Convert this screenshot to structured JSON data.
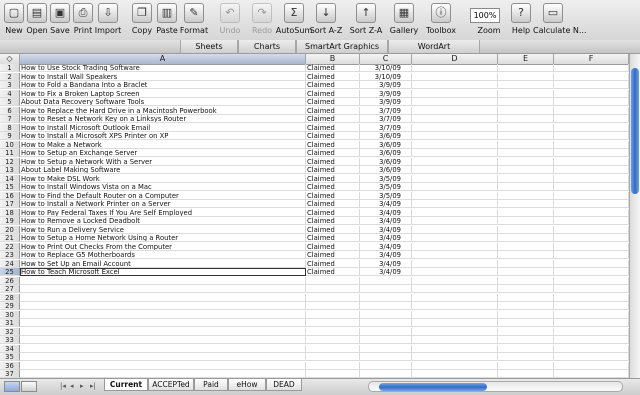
{
  "toolbar": {
    "buttons": [
      {
        "label": "New",
        "glyph": "▢",
        "disabled": false
      },
      {
        "label": "Open",
        "glyph": "▤",
        "disabled": false
      },
      {
        "label": "Save",
        "glyph": "▣",
        "disabled": false
      },
      {
        "label": "Print",
        "glyph": "⎙",
        "disabled": false
      },
      {
        "label": "Import",
        "glyph": "⇩",
        "disabled": false
      },
      {
        "label": "Copy",
        "glyph": "❐",
        "disabled": false
      },
      {
        "label": "Paste",
        "glyph": "▥",
        "disabled": false
      },
      {
        "label": "Format",
        "glyph": "✎",
        "disabled": false
      },
      {
        "label": "Undo",
        "glyph": "↶",
        "disabled": true
      },
      {
        "label": "Redo",
        "glyph": "↷",
        "disabled": true
      },
      {
        "label": "AutoSum",
        "glyph": "Σ",
        "disabled": false
      },
      {
        "label": "Sort A-Z",
        "glyph": "↓",
        "disabled": false
      },
      {
        "label": "Sort Z-A",
        "glyph": "↑",
        "disabled": false
      },
      {
        "label": "Gallery",
        "glyph": "▦",
        "disabled": false
      },
      {
        "label": "Toolbox",
        "glyph": "ⓘ",
        "disabled": false
      },
      {
        "label": "Zoom",
        "glyph": "",
        "disabled": false
      },
      {
        "label": "Help",
        "glyph": "?",
        "disabled": false
      },
      {
        "label": "Calculate N...",
        "glyph": "▭",
        "disabled": false
      }
    ],
    "zoom_value": "100%"
  },
  "ribbon_tabs": [
    "Sheets",
    "Charts",
    "SmartArt Graphics",
    "WordArt"
  ],
  "columns": [
    {
      "label": "◇",
      "selected": false
    },
    {
      "label": "A",
      "selected": true
    },
    {
      "label": "B",
      "selected": false
    },
    {
      "label": "C",
      "selected": false
    },
    {
      "label": "D",
      "selected": false
    },
    {
      "label": "E",
      "selected": false
    },
    {
      "label": "F",
      "selected": false
    }
  ],
  "rows": [
    {
      "n": "1",
      "a": "How to Use Stock Trading Software",
      "b": "Claimed",
      "c": "3/10/09"
    },
    {
      "n": "2",
      "a": "How to Install Wall Speakers",
      "b": "Claimed",
      "c": "3/10/09"
    },
    {
      "n": "3",
      "a": "How to Fold a Bandana Into a Braclet",
      "b": "Claimed",
      "c": "3/9/09"
    },
    {
      "n": "4",
      "a": "How to Fix a Broken Laptop Screen",
      "b": "Claimed",
      "c": "3/9/09"
    },
    {
      "n": "5",
      "a": "About Data Recovery Software Tools",
      "b": "Claimed",
      "c": "3/9/09"
    },
    {
      "n": "6",
      "a": "How to Replace the Hard Drive in a Macintosh Powerbook",
      "b": "Claimed",
      "c": "3/7/09"
    },
    {
      "n": "7",
      "a": "How to Reset a Network Key on a Linksys Router",
      "b": "Claimed",
      "c": "3/7/09"
    },
    {
      "n": "8",
      "a": "How to Install Microsoft Outlook Email",
      "b": "Claimed",
      "c": "3/7/09"
    },
    {
      "n": "9",
      "a": "How to Install a Microsoft XPS Printer on XP",
      "b": "Claimed",
      "c": "3/6/09"
    },
    {
      "n": "10",
      "a": "How to Make a Network",
      "b": "Claimed",
      "c": "3/6/09"
    },
    {
      "n": "11",
      "a": "How to Setup an Exchange Server",
      "b": "Claimed",
      "c": "3/6/09"
    },
    {
      "n": "12",
      "a": "How to Setup a Network With a Server",
      "b": "Claimed",
      "c": "3/6/09"
    },
    {
      "n": "13",
      "a": "About Label Making Software",
      "b": "Claimed",
      "c": "3/6/09"
    },
    {
      "n": "14",
      "a": "How to Make DSL Work",
      "b": "Claimed",
      "c": "3/5/09"
    },
    {
      "n": "15",
      "a": "How to Install Windows Vista on a Mac",
      "b": "Claimed",
      "c": "3/5/09"
    },
    {
      "n": "16",
      "a": "How to Find the Default Router on a Computer",
      "b": "Claimed",
      "c": "3/5/09"
    },
    {
      "n": "17",
      "a": "How to Install a Network Printer on a Server",
      "b": "Claimed",
      "c": "3/4/09"
    },
    {
      "n": "18",
      "a": "How to Pay Federal Taxes If You Are Self Employed",
      "b": "Claimed",
      "c": "3/4/09"
    },
    {
      "n": "19",
      "a": "How to Remove a Locked Deadbolt",
      "b": "Claimed",
      "c": "3/4/09"
    },
    {
      "n": "20",
      "a": "How to Run a Delivery Service",
      "b": "Claimed",
      "c": "3/4/09"
    },
    {
      "n": "21",
      "a": "How to Setup a Home Network Using a Router",
      "b": "Claimed",
      "c": "3/4/09"
    },
    {
      "n": "22",
      "a": "How to Print Out Checks From the Computer",
      "b": "Claimed",
      "c": "3/4/09"
    },
    {
      "n": "23",
      "a": "How to Replace G5 Motherboards",
      "b": "Claimed",
      "c": "3/4/09"
    },
    {
      "n": "24",
      "a": "How to Set Up an Email Account",
      "b": "Claimed",
      "c": "3/4/09"
    },
    {
      "n": "25",
      "a": "How to Teach Microsoft Excel",
      "b": "Claimed",
      "c": "3/4/09"
    },
    {
      "n": "26",
      "a": "",
      "b": "",
      "c": ""
    },
    {
      "n": "27",
      "a": "",
      "b": "",
      "c": ""
    },
    {
      "n": "28",
      "a": "",
      "b": "",
      "c": ""
    },
    {
      "n": "29",
      "a": "",
      "b": "",
      "c": ""
    },
    {
      "n": "30",
      "a": "",
      "b": "",
      "c": ""
    },
    {
      "n": "31",
      "a": "",
      "b": "",
      "c": ""
    },
    {
      "n": "32",
      "a": "",
      "b": "",
      "c": ""
    },
    {
      "n": "33",
      "a": "",
      "b": "",
      "c": ""
    },
    {
      "n": "34",
      "a": "",
      "b": "",
      "c": ""
    },
    {
      "n": "35",
      "a": "",
      "b": "",
      "c": ""
    },
    {
      "n": "36",
      "a": "",
      "b": "",
      "c": ""
    },
    {
      "n": "37",
      "a": "",
      "b": "",
      "c": ""
    }
  ],
  "active_row": "25",
  "sheet_tabs": [
    {
      "label": "Current",
      "active": true
    },
    {
      "label": "ACCEPTed",
      "active": false
    },
    {
      "label": "Paid",
      "active": false
    },
    {
      "label": "eHow",
      "active": false
    },
    {
      "label": "DEAD",
      "active": false
    }
  ],
  "nav_arrows": [
    "|◂",
    "◂",
    "▸",
    "▸|"
  ],
  "colors": {
    "selection": "#a7b5cf",
    "scroll_thumb": "#2f6cc8"
  }
}
